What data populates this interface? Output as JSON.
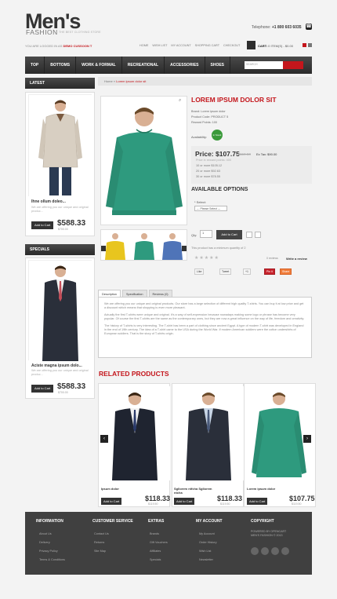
{
  "header": {
    "logo_main": "Men's",
    "logo_sub": "FASHION",
    "tagline": "THE BEST CLOTHING STORE",
    "phone_label": "Telephone:",
    "phone_number": "+1 800 603 6035",
    "welcome_text": "YOU ARE LOGGED IN AS",
    "welcome_user": "DEMO CUSSOON T",
    "topnav": [
      "HOME",
      "WISH LIST",
      "MY ACCOUNT",
      "SHOPPING CART",
      "CHECKOUT"
    ],
    "cart_label": "CART:",
    "cart_items": "0 ITEM(S) - $0.00"
  },
  "menu": {
    "items": [
      "TOP",
      "BOTTOMS",
      "WORK & FORMAL",
      "RECREATIONAL",
      "ACCESSORIES",
      "SHOES"
    ],
    "search_placeholder": "SEARCH"
  },
  "sidebar": {
    "latest_title": "LATEST",
    "latest_product": {
      "name": "Ihne ollum doleo...",
      "desc": "We are offering you our unique and original produc...",
      "price": "$588.33",
      "old_price": "$700.00",
      "button": "Add to Cart"
    },
    "specials_title": "SPECIALS",
    "special_product": {
      "name": "Aciste magna ipsum dolo...",
      "desc": "We are offering you our unique and original produc...",
      "price": "$588.33",
      "old_price": "$700.00",
      "button": "Add to Cart"
    }
  },
  "breadcrumb": {
    "home": "Home",
    "current": "Lorem ipsum dolor sit"
  },
  "product": {
    "name": "LOREM IPSUM DOLOR SIT",
    "brand": "Brand: Lorem ipsum dolor",
    "code": "Product Code: PRODUCT 5",
    "reward": "Reward Points: 100",
    "availability_label": "Availability:",
    "availability": "In Stock",
    "price": "Price: $107.75",
    "old_price": "$119.50",
    "ex_tax": "Ex Tax: $90.00",
    "price_points": "Price in reward points: 400",
    "discounts": [
      "10 or more $105.12",
      "20 or more $92.63",
      "30 or more $78.55"
    ],
    "options_title": "AVAILABLE OPTIONS",
    "select_label": "* Select:",
    "select_value": "--- Please Select ---",
    "qty_label": "Qty:",
    "qty_value": "1",
    "add_to_cart": "Add to Cart",
    "min_qty": "This product has a minimum quantity of 2",
    "reviews": "0 reviews",
    "write_review": "Write a review",
    "share": [
      "Like",
      "Tweet",
      "+1",
      "Pin it",
      "Share"
    ]
  },
  "tabs": [
    "Description",
    "Specification",
    "Reviews (0)"
  ],
  "description": [
    "We are offering you our unique and original products. Our store has a large selection of different high quality T-shirts. You can buy it at low price and get a discount which means that shopping is even more pleasant.",
    "Actually the first T-shirts were unique and original. It's a way of self-expression because nowadays making some logo or phrase has become very popular. Of course the first T-shirts are the same as the contemporary ones, but they are now a great influence on the way of life, freedom and creativity.",
    "The history of T-shirts is very interesting. The T-shirt has been a part of clothing since ancient Egypt. A type of modern T-shirt was developed in England in the end of 19th century. The idea of a T-shirt came to the USA during the World War. If modern American soldiers were the cotton undershirts of European soldiers. That is the story of T-shirts origin."
  ],
  "related": {
    "title": "RELATED PRODUCTS",
    "items": [
      {
        "name": "Ipsum dolor",
        "price": "$118.33",
        "old_price": "$119.50",
        "button": "Add to Cart"
      },
      {
        "name": "Sgllorem ntfcha Sgllorem ntcha",
        "price": "$118.33",
        "old_price": "$119.50",
        "button": "Add to Cart"
      },
      {
        "name": "Lorem ipsum dolor",
        "price": "$107.75",
        "old_price": "$119.50",
        "button": "Add to Cart"
      }
    ]
  },
  "footer": {
    "columns": [
      {
        "title": "INFORMATION",
        "links": [
          "About Us",
          "Delivery",
          "Privacy Policy",
          "Terms & Conditions"
        ]
      },
      {
        "title": "CUSTOMER SERVICE",
        "links": [
          "Contact Us",
          "Returns",
          "Site Map"
        ]
      },
      {
        "title": "EXTRAS",
        "links": [
          "Brands",
          "Gift Vouchers",
          "Affiliates",
          "Specials"
        ]
      },
      {
        "title": "MY ACCOUNT",
        "links": [
          "My Account",
          "Order History",
          "Wish List",
          "Newsletter"
        ]
      },
      {
        "title": "COPYRIGHT",
        "links": []
      }
    ],
    "copyright": "POWERED BY OPENCART MEN'S FASHION © 2013"
  },
  "colors": {
    "accent": "#c4161c",
    "dark": "#333333",
    "green_shirt": "#2e9a7e"
  }
}
